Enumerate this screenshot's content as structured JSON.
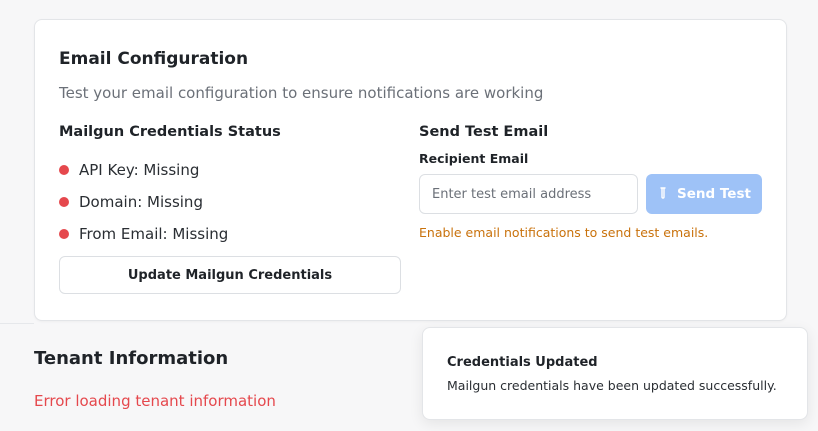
{
  "email_config": {
    "title": "Email Configuration",
    "description": "Test your email configuration to ensure notifications are working",
    "credentials": {
      "heading": "Mailgun Credentials Status",
      "items": [
        {
          "label": "API Key: Missing",
          "status": "missing",
          "color": "#e5484d"
        },
        {
          "label": "Domain: Missing",
          "status": "missing",
          "color": "#e5484d"
        },
        {
          "label": "From Email: Missing",
          "status": "missing",
          "color": "#e5484d"
        }
      ],
      "update_button": "Update Mailgun Credentials"
    },
    "test_email": {
      "heading": "Send Test Email",
      "recipient_label": "Recipient Email",
      "recipient_placeholder": "Enter test email address",
      "recipient_value": "",
      "send_button": "Send Test",
      "send_button_disabled": true,
      "send_icon": "test-tube-icon",
      "hint": "Enable email notifications to send test emails."
    }
  },
  "tenant": {
    "title": "Tenant Information",
    "error": "Error loading tenant information"
  },
  "toast": {
    "title": "Credentials Updated",
    "message": "Mailgun credentials have been updated successfully."
  },
  "colors": {
    "error": "#e5484d",
    "warning": "#c9720c",
    "primary_disabled": "#9ec2f7"
  }
}
